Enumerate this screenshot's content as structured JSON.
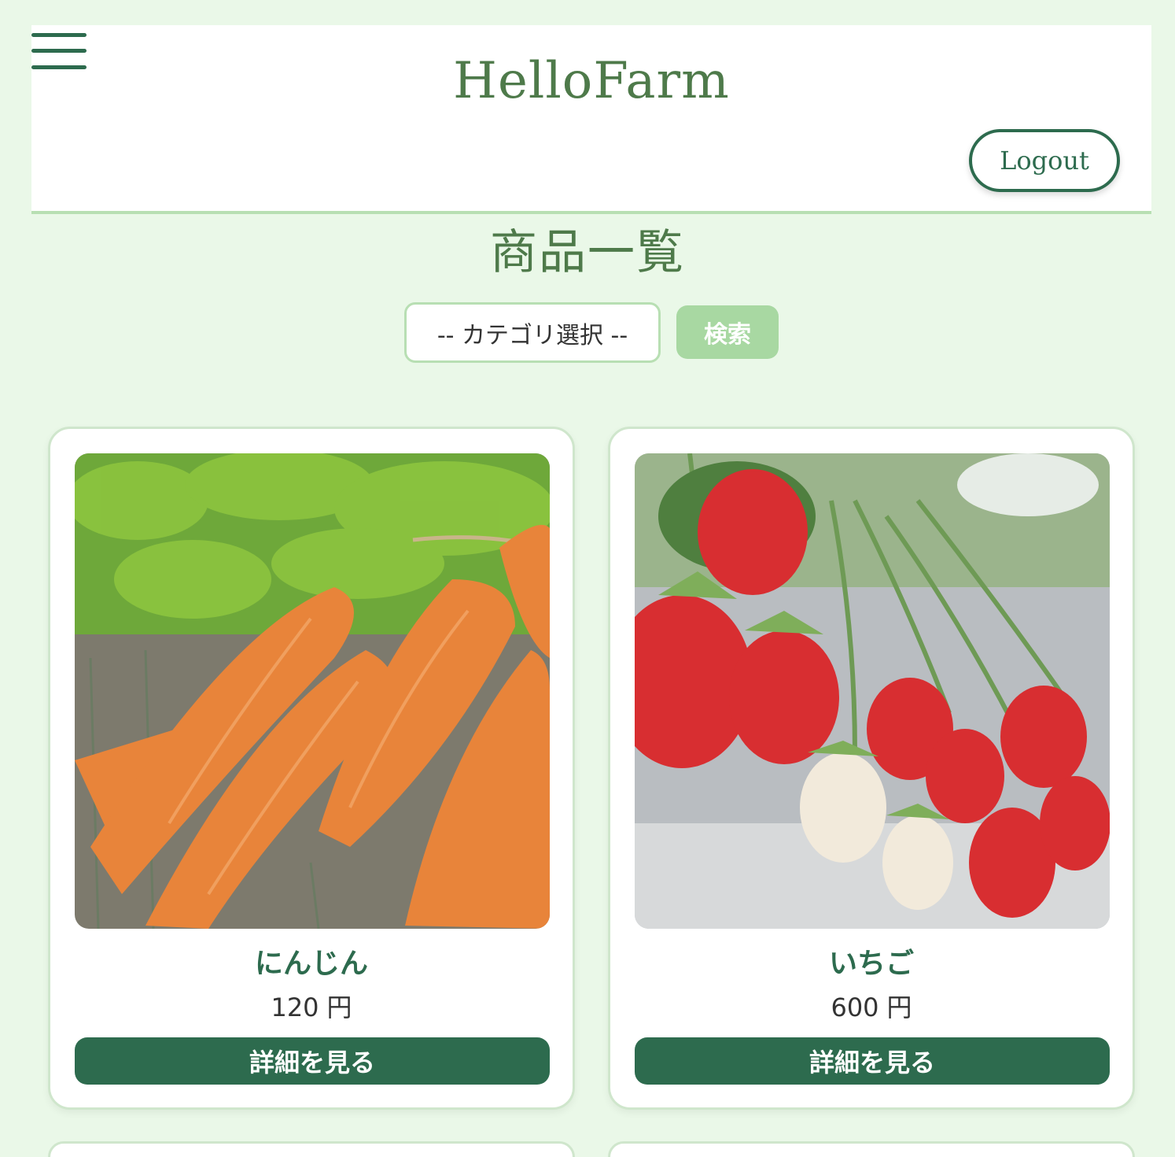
{
  "header": {
    "brand": "HelloFarm",
    "logout_label": "Logout"
  },
  "page_title": "商品一覧",
  "search": {
    "category_selected": "-- カテゴリ選択 --",
    "button_label": "検索"
  },
  "products": [
    {
      "name": "にんじん",
      "price": "120",
      "unit": "円",
      "button_label": "詳細を見る",
      "image": "carrot-photo"
    },
    {
      "name": "いちご",
      "price": "600",
      "unit": "円",
      "button_label": "詳細を見る",
      "image": "strawberry-photo"
    }
  ],
  "colors": {
    "background": "#eaf8e8",
    "primary": "#2d6b4e",
    "brand_text": "#4e7a4a",
    "accent_light": "#a8d8a2",
    "border_light": "#b8dfb3"
  }
}
